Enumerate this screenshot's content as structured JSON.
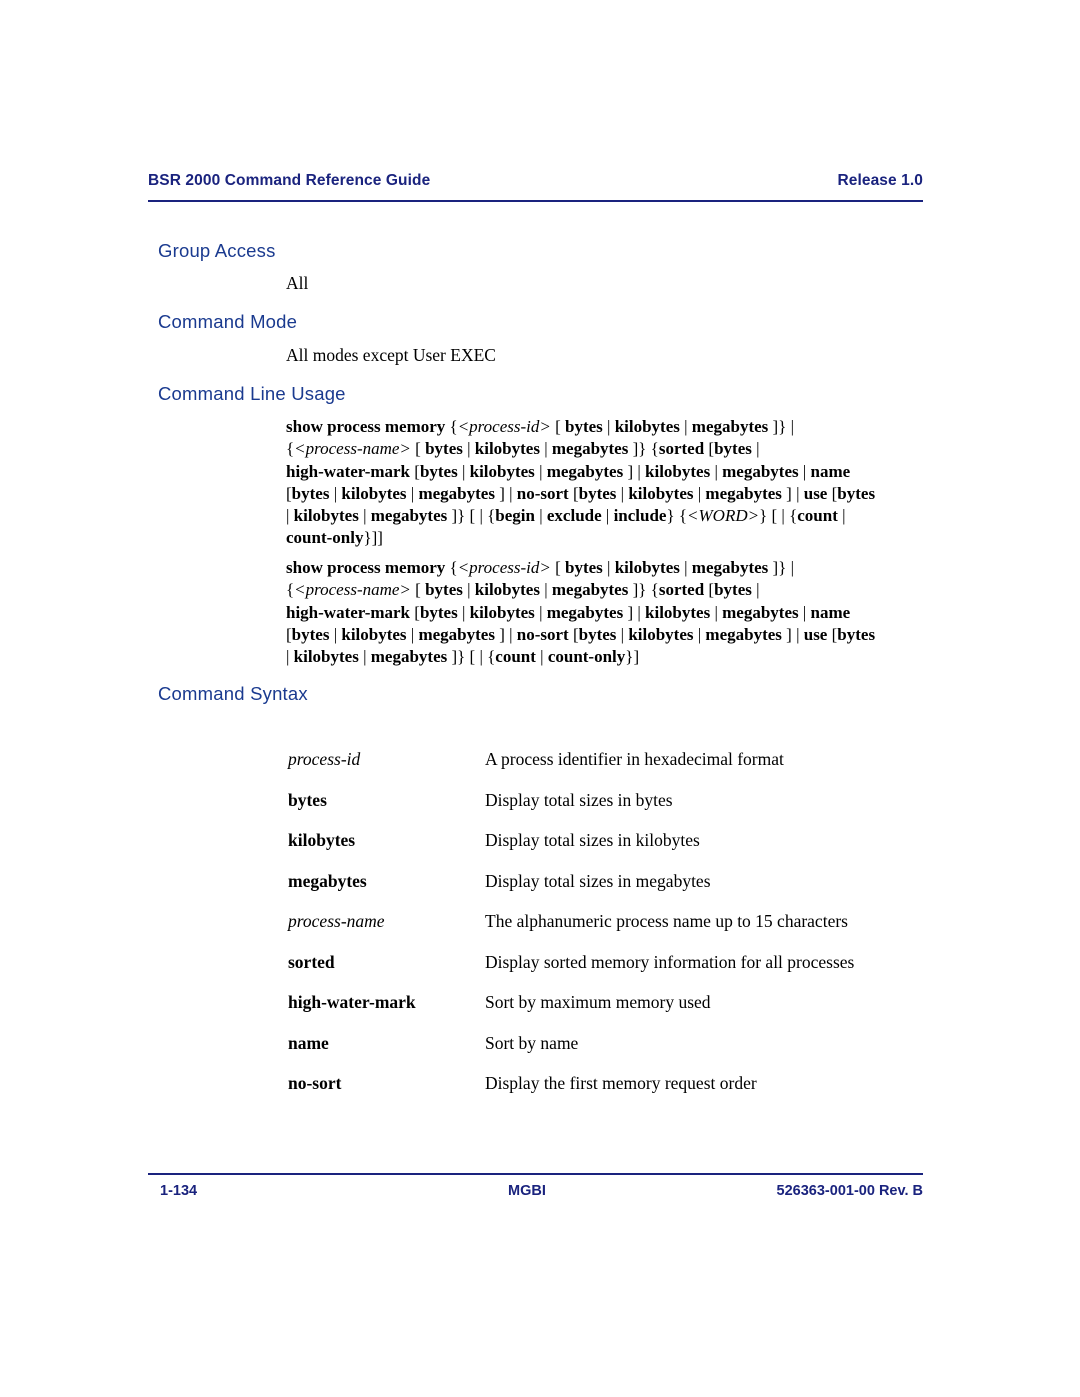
{
  "header": {
    "left": "BSR 2000 Command Reference Guide",
    "right": "Release 1.0"
  },
  "sections": {
    "group_access": {
      "heading": "Group Access",
      "body": "All"
    },
    "command_mode": {
      "heading": "Command Mode",
      "body": "All modes except User EXEC"
    },
    "command_line_usage": {
      "heading": "Command Line Usage"
    },
    "command_syntax": {
      "heading": "Command Syntax"
    }
  },
  "usage": {
    "block1": [
      "<b>show process memory</b> {<i>&lt;process-id&gt;</i> [ <b>bytes</b> | <b>kilobytes</b> | <b>megabytes</b> ]} |",
      "{<i>&lt;process-name&gt;</i> [ <b>bytes</b> | <b>kilobytes</b> | <b>megabytes</b> ]} {<b>sorted</b> [<b>bytes</b> |",
      "<b>high-water-mark</b> [<b>bytes</b> | <b>kilobytes</b> | <b>megabytes</b> ] | <b>kilobytes</b> |  <b>megabytes</b> | <b>name</b>",
      "[<b>bytes</b> | <b>kilobytes</b> | <b>megabytes</b> ] | <b>no-sort</b> [<b>bytes</b> | <b>kilobytes</b> | <b>megabytes</b> ] | <b>use</b> [<b>bytes</b>",
      "| <b>kilobytes</b> | <b>megabytes</b> ]} [ | {<b>begin</b> | <b>exclude</b> | <b>include</b>} {<i>&lt;WORD&gt;</i>} [ | {<b>count</b> |",
      "<b>count-only</b>}]]"
    ],
    "block2": [
      "<b>show process memory</b> {<i>&lt;process-id&gt;</i> [ <b>bytes</b> | <b>kilobytes</b> | <b>megabytes</b> ]} |",
      "{<i>&lt;process-name&gt;</i> [ <b>bytes</b> | <b>kilobytes</b> | <b>megabytes</b> ]} {<b>sorted</b> [<b>bytes</b> |",
      "<b>high-water-mark</b> [<b>bytes</b> | <b>kilobytes</b> | <b>megabytes</b> ] | <b>kilobytes</b> |  <b>megabytes</b> | <b>name</b>",
      "[<b>bytes</b> | <b>kilobytes</b> | <b>megabytes</b> ] | <b>no-sort</b> [<b>bytes</b> | <b>kilobytes</b> | <b>megabytes</b> ] | <b>use</b> [<b>bytes</b>",
      "| <b>kilobytes</b> | <b>megabytes</b> ]} [ | {<b>count</b> | <b>count-only</b>}]"
    ]
  },
  "syntax_rows": [
    {
      "term": "process-id",
      "italic": true,
      "definition": "A process identifier in hexadecimal format"
    },
    {
      "term": "bytes",
      "italic": false,
      "definition": "Display total sizes in bytes"
    },
    {
      "term": "kilobytes",
      "italic": false,
      "definition": "Display total sizes in kilobytes"
    },
    {
      "term": "megabytes",
      "italic": false,
      "definition": "Display total sizes in megabytes"
    },
    {
      "term": "process-name",
      "italic": true,
      "definition": "The alphanumeric process name up to 15 characters"
    },
    {
      "term": "sorted",
      "italic": false,
      "definition": "Display sorted memory information for all processes"
    },
    {
      "term": "high-water-mark",
      "italic": false,
      "definition": "Sort by maximum memory used"
    },
    {
      "term": "name",
      "italic": false,
      "definition": "Sort by name"
    },
    {
      "term": "no-sort",
      "italic": false,
      "definition": "Display the first memory request order"
    }
  ],
  "footer": {
    "page_number": "1-134",
    "center": "MGBI",
    "right": "526363-001-00 Rev. B"
  }
}
